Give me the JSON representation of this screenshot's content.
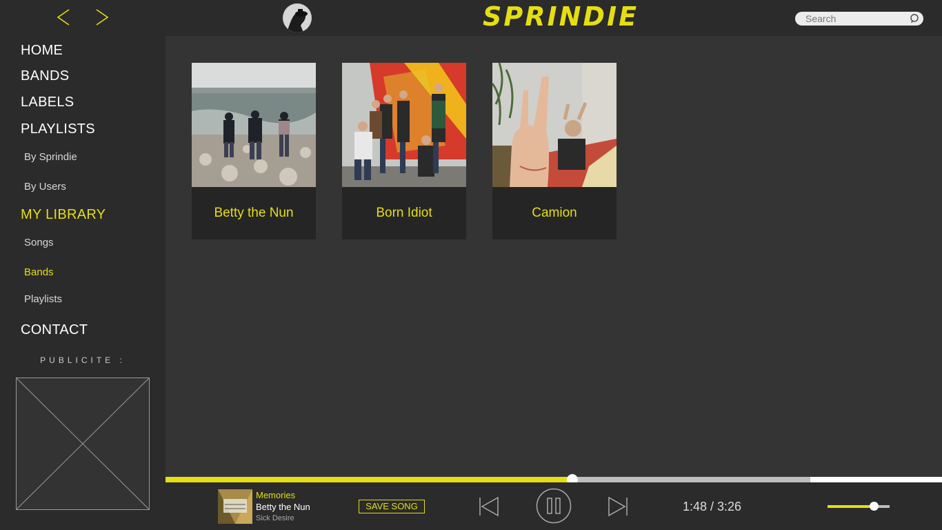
{
  "app": {
    "logo": "SPRINDIE",
    "brand_color": "#e6df10"
  },
  "search": {
    "placeholder": "Search"
  },
  "sidebar": {
    "home": "HOME",
    "bands": "BANDS",
    "labels": "LABELS",
    "playlists": "PLAYLISTS",
    "by_sprindie": "By Sprindie",
    "by_users": "By Users",
    "my_library": "MY LIBRARY",
    "songs": "Songs",
    "lib_bands": "Bands",
    "lib_playlists": "Playlists",
    "contact": "CONTACT",
    "ad_label": "PUBLICITE :"
  },
  "main": {
    "bands": [
      {
        "name": "Betty the Nun"
      },
      {
        "name": "Born Idiot"
      },
      {
        "name": "Camion"
      }
    ]
  },
  "player": {
    "track_title": "Memories",
    "track_band": "Betty the Nun",
    "track_album": "Sick Desire",
    "save_label": "SAVE SONG",
    "time_display": "1:48 / 3:26",
    "progress_fraction": 0.524,
    "buffered_fraction": 0.83,
    "volume_fraction": 0.74
  }
}
